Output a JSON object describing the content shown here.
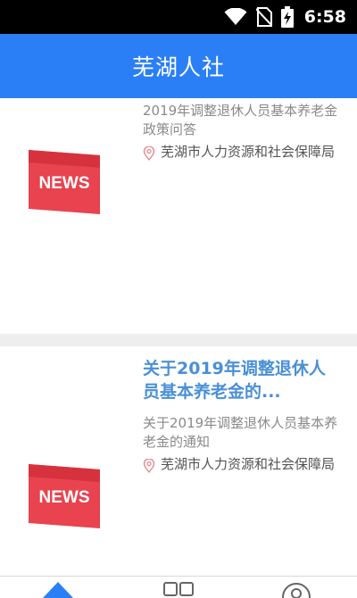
{
  "status_bar": {
    "time": "6:58"
  },
  "app_bar": {
    "title": "芜湖人社"
  },
  "articles": [
    {
      "thumb_text": "NEWS",
      "summary": "2019年调整退休人员基本养老金政策问答",
      "source": "芜湖市人力资源和社会保障局"
    },
    {
      "thumb_text": "NEWS",
      "title": "关于2019年调整退休人员基本养老金的...",
      "summary": "关于2019年调整退休人员基本养老金的通知",
      "source": "芜湖市人力资源和社会保障局"
    }
  ],
  "colors": {
    "accent": "#2b7ff6",
    "news_red": "#e8434f",
    "link": "#4a90d6"
  },
  "bottom_nav": {
    "items": [
      "home-icon",
      "grid-icon",
      "profile-icon"
    ]
  }
}
